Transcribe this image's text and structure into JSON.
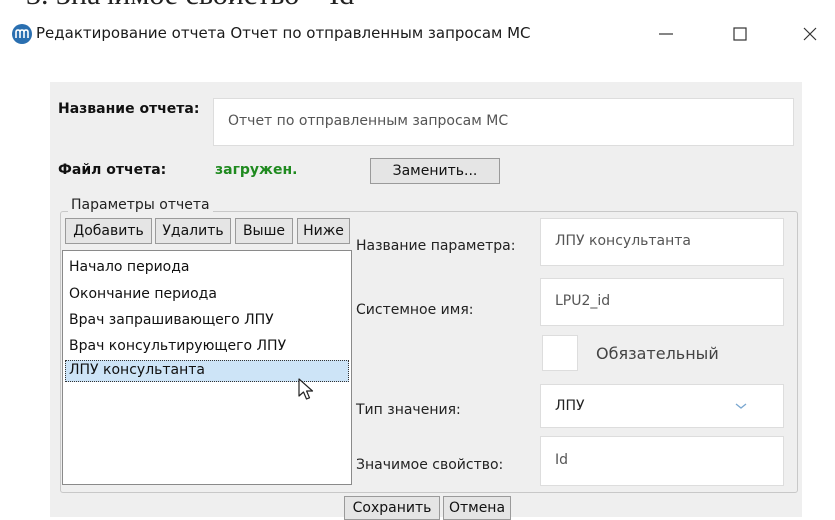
{
  "doc_heading": "3. Значимое свойство – Id",
  "window": {
    "title": "Редактирование отчета Отчет по отправленным запросам МС",
    "controls": {
      "minimize": "minimize-icon",
      "maximize": "maximize-icon",
      "close": "close-icon"
    }
  },
  "report": {
    "name_label": "Название отчета:",
    "name_value": "Отчет по отправленным запросам МС",
    "file_label": "Файл отчета:",
    "file_status": "загружен.",
    "replace_button": "Заменить..."
  },
  "params": {
    "group_title": "Параметры отчета",
    "buttons": {
      "add": "Добавить",
      "delete": "Удалить",
      "up": "Выше",
      "down": "Ниже"
    },
    "items": [
      "Начало периода",
      "Окончание периода",
      "Врач запрашивающего ЛПУ",
      "Врач консультирующего ЛПУ",
      "ЛПУ консультанта"
    ],
    "selected_index": 4
  },
  "detail": {
    "param_name_label": "Название параметра:",
    "param_name_value": "ЛПУ консультанта",
    "system_name_label": "Системное имя:",
    "system_name_value": "LPU2_id",
    "required_label": "Обязательный",
    "required_checked": false,
    "value_type_label": "Тип значения:",
    "value_type_value": "ЛПУ",
    "key_property_label": "Значимое свойство:",
    "key_property_value": "Id"
  },
  "footer": {
    "save": "Сохранить",
    "cancel": "Отмена"
  },
  "colors": {
    "status_ok": "#1f8a1f",
    "selection": "#cde4f7",
    "panel": "#efefef",
    "app_icon": "#2a6fb0"
  }
}
